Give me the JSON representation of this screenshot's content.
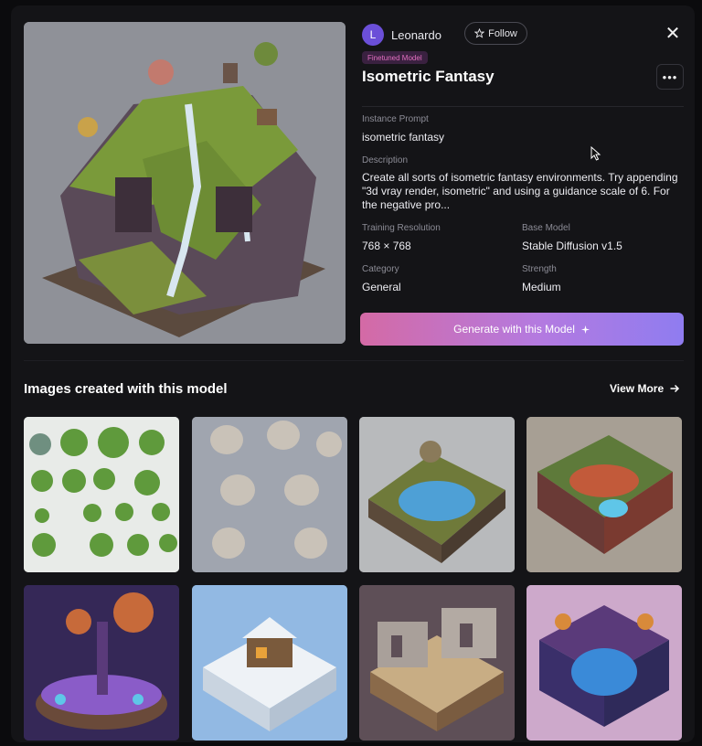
{
  "author": {
    "initial": "L",
    "name": "Leonardo"
  },
  "follow_label": "Follow",
  "close_glyph": "✕",
  "badge": "Finetuned Model",
  "title": "Isometric Fantasy",
  "more_glyph": "•••",
  "fields": {
    "instance_prompt": {
      "label": "Instance Prompt",
      "value": "isometric fantasy"
    },
    "description": {
      "label": "Description",
      "value": "Create all sorts of isometric fantasy environments. Try appending \"3d vray render, isometric\" and using a guidance scale of 6. For the negative pro..."
    },
    "training_resolution": {
      "label": "Training Resolution",
      "value": "768 × 768"
    },
    "base_model": {
      "label": "Base Model",
      "value": "Stable Diffusion v1.5"
    },
    "category": {
      "label": "Category",
      "value": "General"
    },
    "strength": {
      "label": "Strength",
      "value": "Medium"
    }
  },
  "generate_label": "Generate with this Model",
  "gallery": {
    "title": "Images created with this model",
    "view_more": "View More",
    "items": [
      {
        "name": "isometric-trees-sprites"
      },
      {
        "name": "isometric-kittens-sprites"
      },
      {
        "name": "isometric-pond-island"
      },
      {
        "name": "isometric-lava-cave"
      },
      {
        "name": "isometric-magic-tree"
      },
      {
        "name": "isometric-snow-house"
      },
      {
        "name": "isometric-ruins"
      },
      {
        "name": "isometric-crystal-island"
      }
    ]
  },
  "colors": {
    "accent_start": "#d46aa5",
    "accent_end": "#8f7cf0",
    "badge_text": "#e36fc1",
    "avatar": "#6b4fd8"
  },
  "icons": [
    "star-icon",
    "close-icon",
    "more-icon",
    "sparkle-icon",
    "arrow-right-icon",
    "cursor-icon"
  ]
}
